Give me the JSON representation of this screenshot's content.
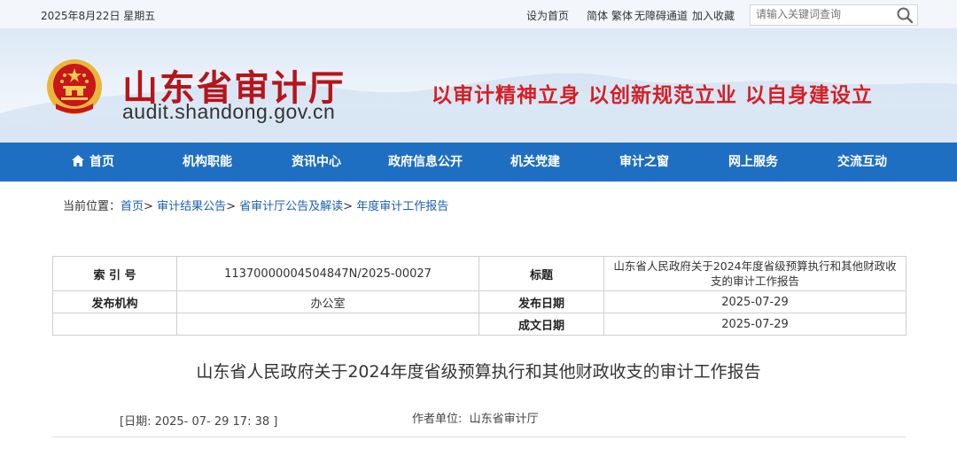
{
  "topbar": {
    "date": "2025年8月22日 星期五",
    "set_home": "设为首页",
    "simplified": "简体",
    "traditional": "繁体",
    "accessible": "无障碍通道",
    "favorite": "加入收藏",
    "search_placeholder": "请输入关键词查询",
    "search_icon": "search-icon"
  },
  "header": {
    "site_name": "山东省审计厅",
    "domain": "audit.shandong.gov.cn",
    "slogan": "以审计精神立身 以创新规范立业 以自身建设立",
    "emblem_icon": "national-emblem-icon"
  },
  "nav": {
    "items": [
      "首页",
      "机构职能",
      "资讯中心",
      "政府信息公开",
      "机关党建",
      "审计之窗",
      "网上服务",
      "交流互动"
    ],
    "home_icon": "home-icon"
  },
  "breadcrumb": {
    "prefix": "当前位置：",
    "items": [
      "首页",
      "审计结果公告",
      "省审计厅公告及解读",
      "年度审计工作报告"
    ],
    "separator": ">"
  },
  "meta_table": {
    "index_label": "索 引 号",
    "index_value": "11370000004504847N/2025-00027",
    "title_label": "标题",
    "title_value": "山东省人民政府关于2024年度省级预算执行和其他财政收支的审计工作报告",
    "publisher_label": "发布机构",
    "publisher_value": "办公室",
    "pub_date_label": "发布日期",
    "pub_date_value": "2025-07-29",
    "created_date_label": "成文日期",
    "created_date_value": "2025-07-29"
  },
  "article": {
    "title": "山东省人民政府关于2024年度省级预算执行和其他财政收支的审计工作报告",
    "date_line": "[日期:  2025- 07- 29 17: 38 ]",
    "author_label": "作者单位:",
    "author_value": "山东省审计厅"
  },
  "colors": {
    "nav_bg": "#1e6ec1",
    "title_red": "#b5151b",
    "slogan_red": "#d41f27",
    "link_blue": "#1a5fb4"
  }
}
